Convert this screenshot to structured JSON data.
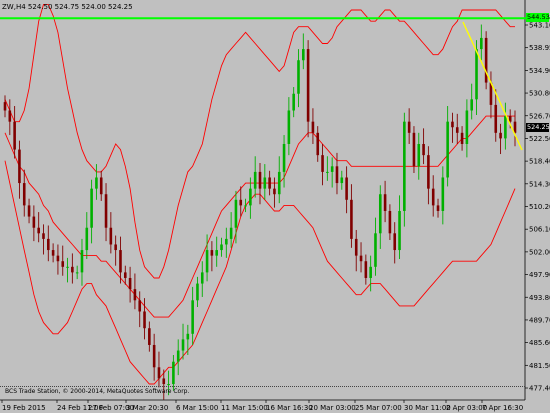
{
  "header": {
    "symbol_label": "ZW,H4",
    "ohlc_text": "524.50 524.75 524.00 524.25"
  },
  "footer": {
    "copyright": "BCS Trade Station, © 2000-2014, MetaQuotes Software Corp."
  },
  "price_labels": {
    "horizontal_line_value": "544.53",
    "current_price": "524.25"
  },
  "colors": {
    "background": "#c0c0c0",
    "bull_candle": "#00b000",
    "bear_candle": "#800000",
    "bands": "#ff0000",
    "horizontal_line": "#00ff00",
    "trend_line": "#ffff00"
  },
  "chart_data": {
    "type": "candlestick",
    "y_tick_labels": [
      "543.10",
      "538.95",
      "534.90",
      "530.80",
      "526.70",
      "522.50",
      "518.40",
      "514.30",
      "510.20",
      "506.10",
      "502.00",
      "497.90",
      "493.80",
      "489.70",
      "485.60",
      "481.50",
      "477.40"
    ],
    "x_tick_labels": [
      "19 Feb 2015",
      "24 Feb 11:00",
      "27 Feb 07:00",
      "3 Mar 20:30",
      "6 Mar 15:00",
      "11 Mar 15:00",
      "16 Mar 16:30",
      "20 Mar 03:00",
      "25 Mar 07:00",
      "30 Mar 11:00",
      "2 Apr 03:00",
      "7 Apr 16:30"
    ],
    "ylim": [
      476.5,
      546
    ],
    "close_path": [
      528,
      526,
      521,
      515,
      511,
      509,
      507,
      506,
      505,
      503,
      502,
      501,
      500,
      500,
      499,
      499,
      503,
      507,
      514,
      516,
      513,
      507,
      504,
      503,
      499,
      498,
      496,
      494,
      492,
      489,
      486,
      482,
      480,
      479,
      479,
      483,
      485,
      487,
      488,
      494,
      497,
      499,
      503,
      502,
      503,
      504,
      505,
      507,
      512,
      511,
      511,
      514,
      517,
      514,
      516,
      514,
      513,
      517,
      522,
      528,
      531,
      537,
      539,
      526,
      524,
      520,
      517,
      517,
      518,
      515,
      516,
      512,
      505,
      502,
      501,
      498,
      500,
      506,
      513,
      510,
      506,
      503,
      510,
      526,
      524,
      518,
      522,
      520,
      514,
      511,
      510,
      516,
      526,
      525,
      524,
      522,
      528,
      530,
      539,
      541,
      533,
      529,
      524,
      523,
      527,
      526,
      524
    ],
    "upper_band": [
      530,
      528,
      526,
      526,
      528,
      532,
      538,
      544,
      547,
      547,
      545,
      542,
      537,
      532,
      528,
      524,
      521,
      519,
      518,
      517,
      517,
      518,
      520,
      522,
      521,
      518,
      514,
      508,
      503,
      500,
      499,
      498,
      498,
      500,
      503,
      507,
      511,
      514,
      517,
      518,
      520,
      522,
      526,
      530,
      533,
      536,
      538,
      539,
      540,
      541,
      542,
      541,
      540,
      539,
      538,
      537,
      536,
      535,
      536,
      539,
      542,
      543,
      543,
      543,
      542,
      541,
      540,
      540,
      541,
      543,
      544,
      545,
      546,
      546,
      546,
      545,
      544,
      544,
      545,
      546,
      546,
      545,
      544,
      544,
      543,
      542,
      541,
      540,
      539,
      538,
      538,
      539,
      541,
      543,
      544,
      546,
      546,
      546,
      546,
      546,
      546,
      546,
      546,
      545,
      544,
      543,
      543
    ],
    "lower_band": [
      519,
      515,
      511,
      507,
      503,
      499,
      495,
      492,
      490,
      489,
      488,
      488,
      489,
      490,
      492,
      494,
      496,
      497,
      497,
      495,
      494,
      493,
      491,
      489,
      487,
      485,
      483,
      482,
      481,
      480,
      479,
      479,
      480,
      481,
      482,
      482,
      483,
      484,
      485,
      486,
      488,
      490,
      492,
      494,
      496,
      498,
      500,
      503,
      506,
      509,
      511,
      512,
      513,
      513,
      512,
      511,
      510,
      510,
      511,
      511,
      511,
      510,
      509,
      508,
      507,
      505,
      503,
      501,
      500,
      499,
      498,
      497,
      496,
      495,
      495,
      496,
      497,
      497,
      497,
      496,
      495,
      494,
      493,
      493,
      493,
      493,
      494,
      495,
      496,
      497,
      498,
      499,
      500,
      501,
      501,
      501,
      501,
      501,
      501,
      502,
      503,
      504,
      506,
      508,
      510,
      512,
      514
    ],
    "middle_band": [
      524,
      522,
      520,
      518,
      517,
      515,
      514,
      513,
      511,
      510,
      508,
      507,
      506,
      505,
      504,
      503,
      502,
      502,
      502,
      502,
      501,
      501,
      500,
      499,
      498,
      497,
      496,
      495,
      494,
      493,
      492,
      491,
      491,
      491,
      491,
      492,
      493,
      494,
      496,
      498,
      500,
      502,
      504,
      506,
      508,
      510,
      511,
      512,
      513,
      514,
      515,
      515,
      515,
      515,
      515,
      515,
      515,
      515,
      516,
      518,
      520,
      522,
      523,
      524,
      524,
      523,
      522,
      521,
      520,
      519,
      519,
      519,
      518,
      518,
      518,
      518,
      518,
      518,
      518,
      518,
      518,
      518,
      518,
      518,
      518,
      518,
      518,
      518,
      518,
      518,
      518,
      519,
      520,
      521,
      522,
      523,
      523,
      524,
      525,
      526,
      527,
      527,
      527,
      527,
      527,
      527,
      527
    ],
    "horizontal_line": 544.53,
    "current_price": 524.25,
    "grid": false
  }
}
